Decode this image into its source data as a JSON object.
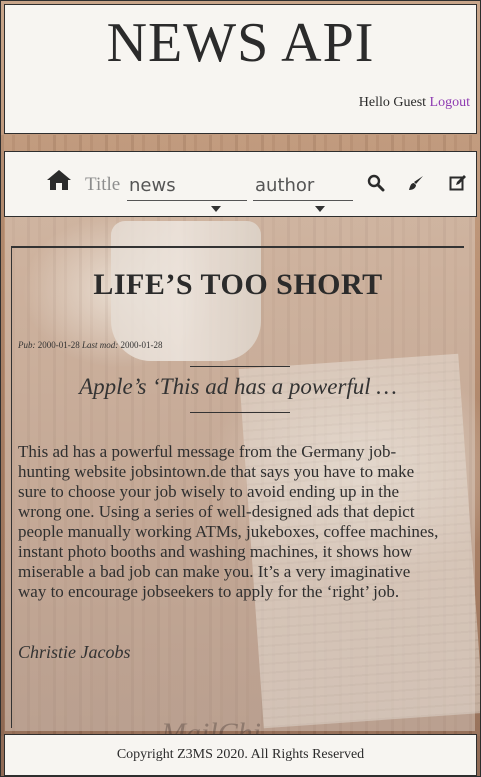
{
  "header": {
    "title": "NEWS API",
    "greeting": "Hello Guest",
    "logout_label": "Logout"
  },
  "toolbar": {
    "title_label": "Title",
    "news_value": "news",
    "author_value": "author",
    "icons": [
      "home-icon",
      "search-icon",
      "brush-icon",
      "edit-icon"
    ]
  },
  "article": {
    "title": "LIFE’S TOO SHORT",
    "pub_label": "Pub:",
    "pub_date": "2000-01-28",
    "mod_label": "Last mod:",
    "mod_date": "2000-01-28",
    "subtitle": "Apple’s ‘This ad has a powerful …",
    "body": "This ad has a powerful message from the Germany job-hunting website jobsintown.de that says you have to make sure to choose your job wisely to avoid ending up in the wrong one. Using a series of well-designed ads that depict people manually working ATMs, jukeboxes, coffee machines, instant photo booths and washing machines, it shows how miserable a bad job can make you. It’s a very imaginative way to encourage jobseekers to apply for the ‘right’ job.",
    "author": "Christie Jacobs"
  },
  "next_article_partial": "MailChi",
  "footer": {
    "copyright": "Copyright Z3MS 2020. All Rights Reserved"
  }
}
